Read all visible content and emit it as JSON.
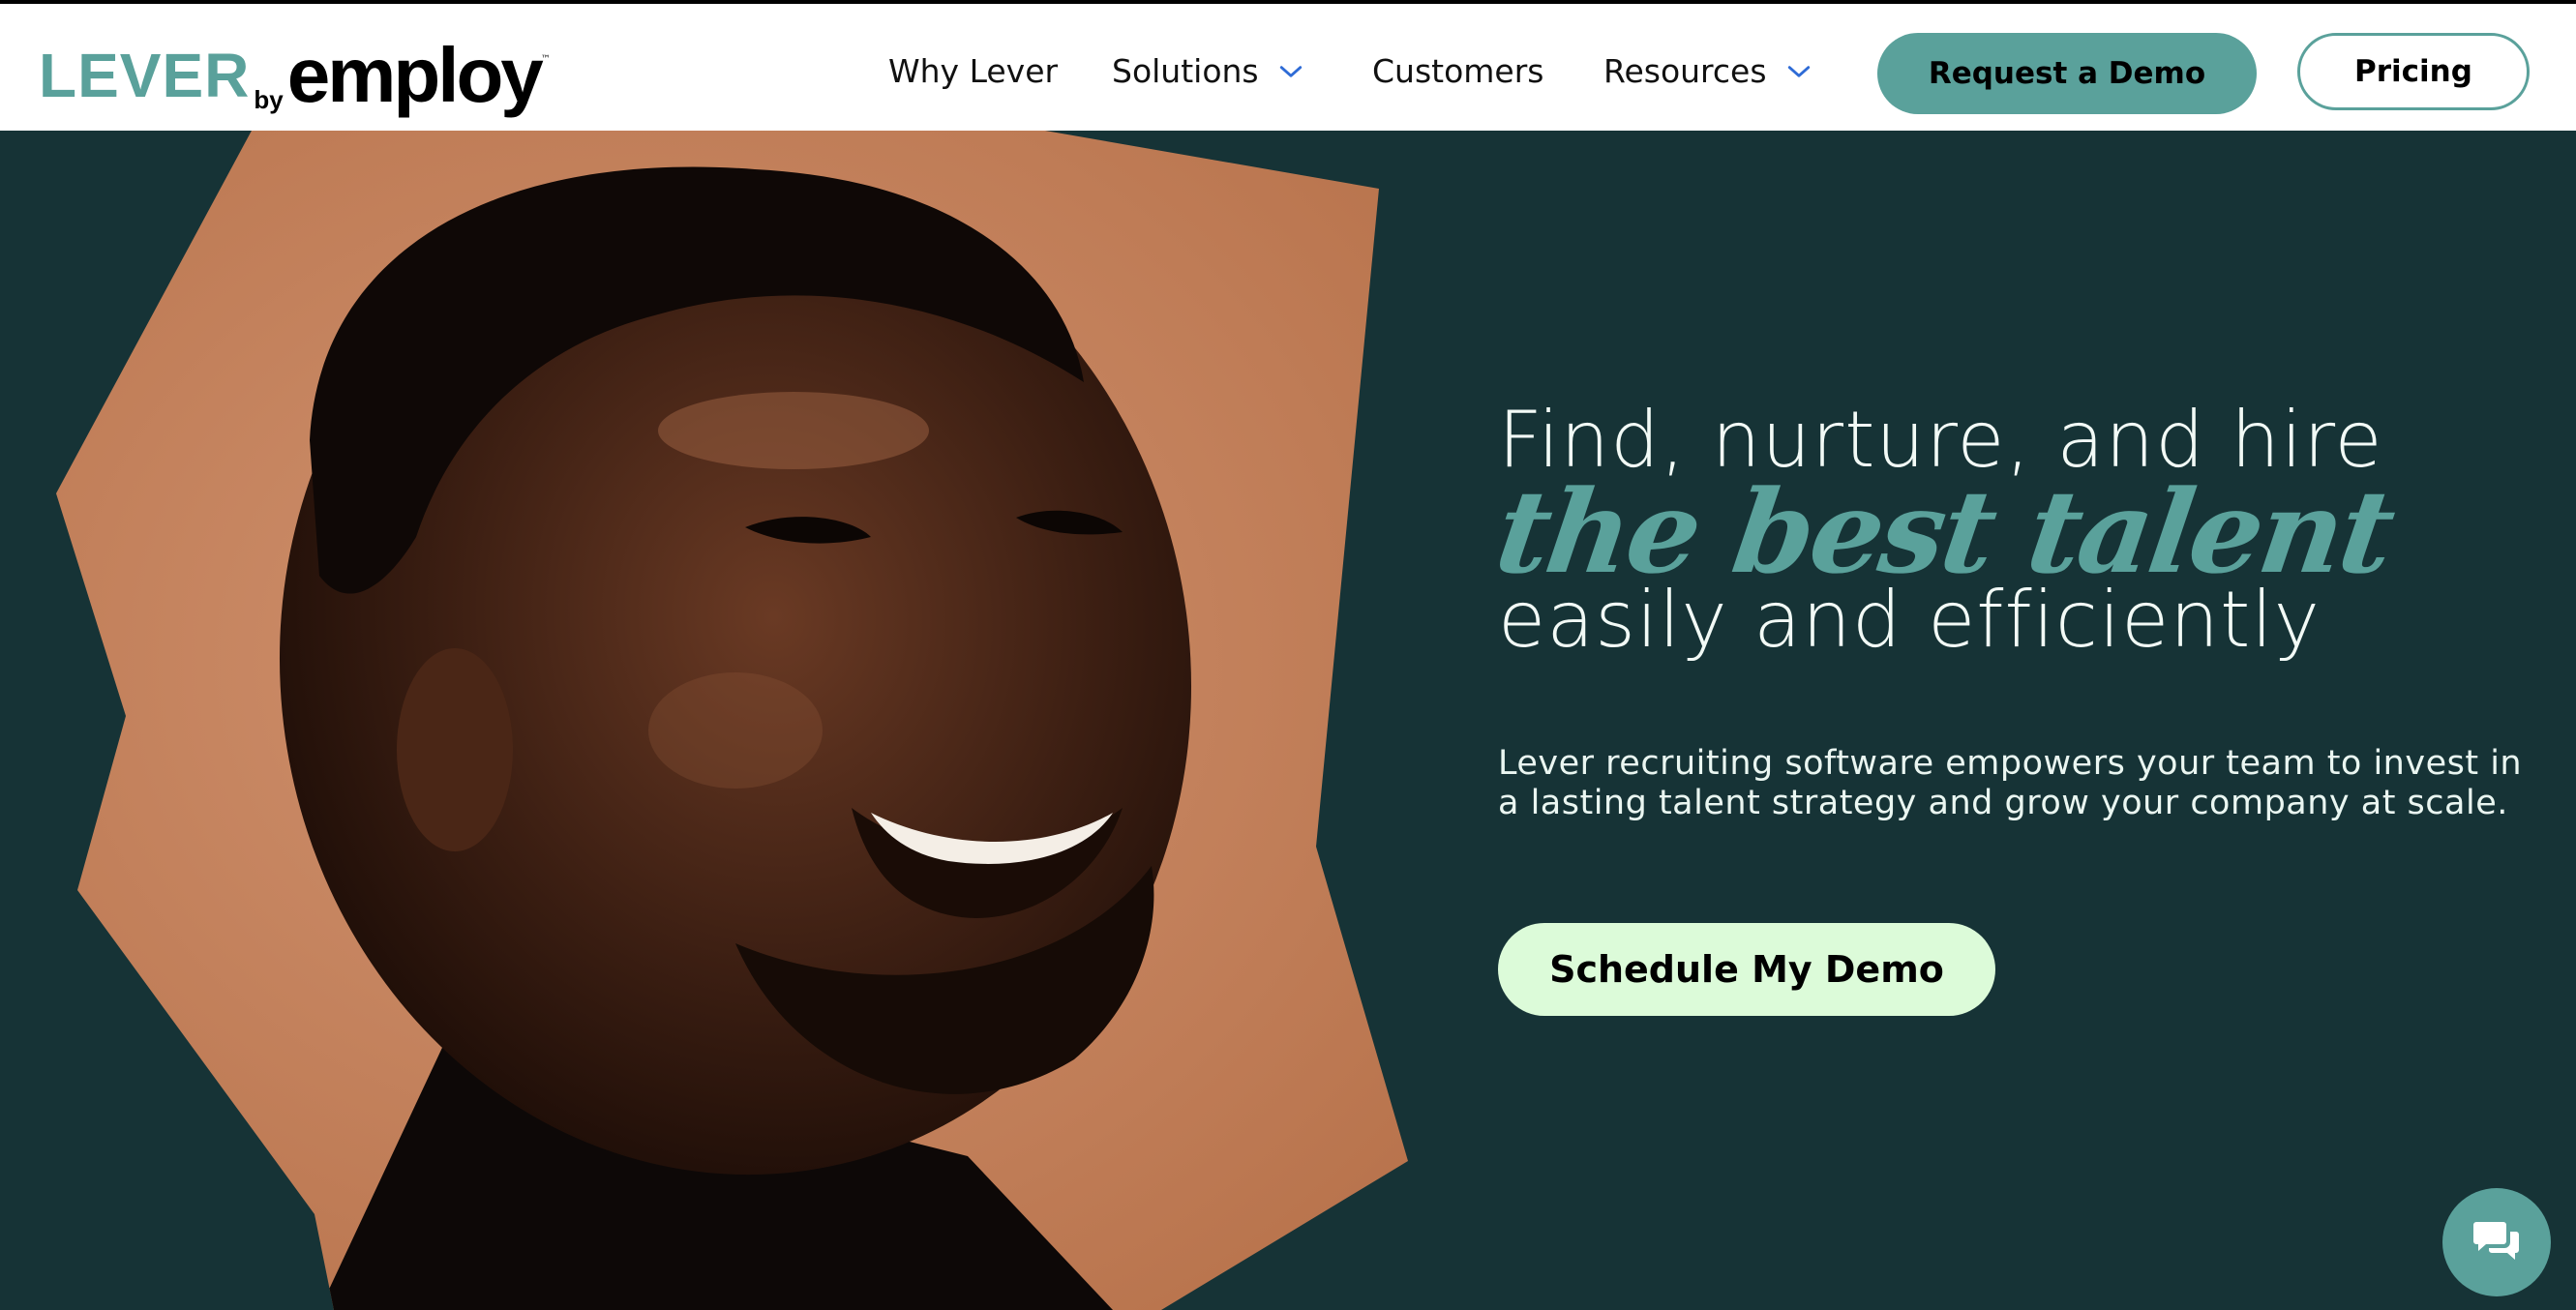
{
  "logo": {
    "part1": "LEVER",
    "by": "by",
    "part2": "employ",
    "tm": "™"
  },
  "nav": {
    "items": [
      {
        "label": "Why Lever"
      },
      {
        "label": "Solutions"
      },
      {
        "label": "Customers"
      },
      {
        "label": "Resources"
      }
    ],
    "cta_demo": "Request a Demo",
    "cta_pricing": "Pricing"
  },
  "hero": {
    "line1": "Find, nurture, and hire",
    "accent": "the best talent",
    "line3": "easily and efficiently",
    "subtext": "Lever recruiting software empowers your team to invest in a lasting talent strategy and grow your company at scale.",
    "cta": "Schedule My Demo",
    "image": "smiling-man-portrait"
  },
  "chat": {
    "icon": "chat-bubbles-icon"
  },
  "colors": {
    "brand_teal": "#5aa19b",
    "hero_bg": "#163336",
    "portrait_bg": "#c8865c",
    "cta_light": "#dcfbd9",
    "text_light": "#f2faf6"
  }
}
